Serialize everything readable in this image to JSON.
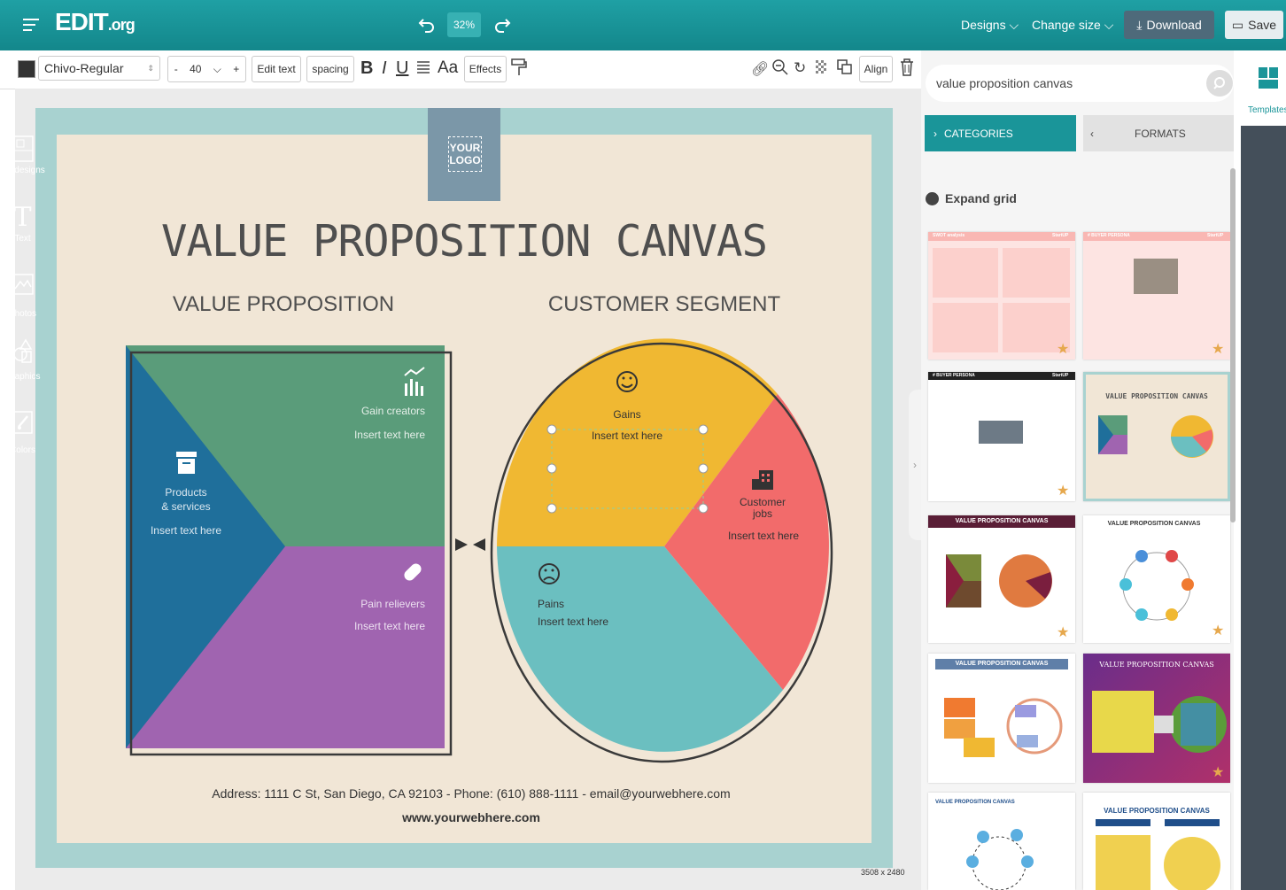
{
  "topbar": {
    "logo": "EDIT",
    "logo_suffix": ".org",
    "zoom": "32%",
    "designs_label": "Designs",
    "change_size_label": "Change size",
    "download_label": "Download",
    "save_label": "Save"
  },
  "toolbar": {
    "font_name": "Chivo-Regular",
    "minus": "-",
    "font_size": "40",
    "plus": "+",
    "edit_text": "Edit text",
    "spacing": "spacing",
    "bold": "B",
    "italic": "I",
    "underline": "U",
    "case": "Aa",
    "effects": "Effects",
    "align": "Align"
  },
  "design": {
    "logo_line1": "YOUR",
    "logo_line2": "LOGO",
    "title": "VALUE PROPOSITION CANVAS",
    "left_heading": "VALUE PROPOSITION",
    "right_heading": "CUSTOMER SEGMENT",
    "gain_creators": "Gain creators",
    "gain_creators_text": "Insert text here",
    "products_line1": "Products",
    "products_line2": "& services",
    "products_text": "Insert text here",
    "pain_relievers": "Pain relievers",
    "pain_relievers_text": "Insert text here",
    "gains": "Gains",
    "gains_text": "Insert text here",
    "customer_line1": "Customer",
    "customer_line2": "jobs",
    "customer_text": "Insert text here",
    "pains": "Pains",
    "pains_text": "Insert text here",
    "address": "Address: 1111 C St, San Diego, CA 92103 - Phone: (610) 888-1111 - email@yourwebhere.com",
    "website": "www.yourwebhere.com",
    "dimensions": "3508 x 2480"
  },
  "panel": {
    "search_value": "value proposition canvas",
    "categories_label": "CATEGORIES",
    "formats_label": "FORMATS",
    "expand_grid": "Expand grid",
    "thumbnails": [
      {
        "title": "SWOT analysis",
        "badge": "StartUP"
      },
      {
        "title": "# BUYER PERSONA",
        "badge": "StartUP"
      },
      {
        "title": "# BUYER PERSONA",
        "badge": "StartUP"
      },
      {
        "title": "VALUE PROPOSITION CANVAS",
        "badge": ""
      },
      {
        "title": "VALUE PROPOSITION CANVAS",
        "badge": ""
      },
      {
        "title": "VALUE PROPOSITION CANVAS",
        "badge": ""
      },
      {
        "title": "VALUE PROPOSITION CANVAS",
        "badge": ""
      },
      {
        "title": "VALUE PROPOSITION CANVAS",
        "badge": ""
      },
      {
        "title": "VALUE PROPOSITION CANVAS",
        "badge": ""
      },
      {
        "title": "VALUE PROPOSITION CANVAS",
        "badge": ""
      }
    ]
  },
  "rail": {
    "templates": "Templates",
    "my_designs": "My designs",
    "text": "Text",
    "photos": "Photos",
    "graphics": "Graphics",
    "colors": "Colors"
  },
  "colors": {
    "teal": "#1a9599",
    "green": "#5a9c7a",
    "blue": "#1f6f9b",
    "purple": "#a064b0",
    "yellow": "#f0b832",
    "coral": "#f26b6b",
    "cyan": "#6bbfc0"
  }
}
